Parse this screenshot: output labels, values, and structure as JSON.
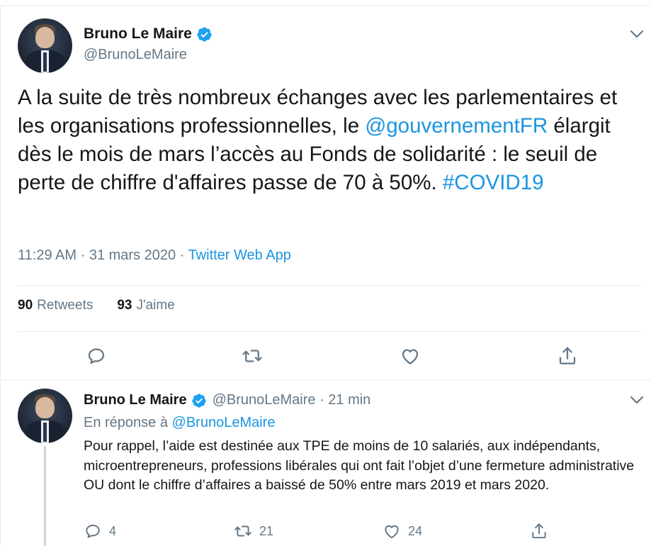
{
  "main_tweet": {
    "display_name": "Bruno Le Maire",
    "handle": "@BrunoLeMaire",
    "text": {
      "part1": "A la suite de très nombreux échanges avec les parlementaires et les organisations professionnelles, le ",
      "mention": "@gouvernementFR",
      "part2": " élargit dès le mois de mars l’accès au Fonds de solidarité : le seuil de perte de chiffre d'affaires passe de 70 à 50%. ",
      "hashtag": "#COVID19"
    },
    "time": "11:29 AM",
    "date": "31 mars 2020",
    "separator": "·",
    "source": "Twitter Web App",
    "retweets_count": "90",
    "retweets_label": "Retweets",
    "likes_count": "93",
    "likes_label": "J'aime"
  },
  "reply_tweet": {
    "display_name": "Bruno Le Maire",
    "handle_time": "@BrunoLeMaire · 21 min",
    "in_reply_prefix": "En réponse à ",
    "in_reply_handle": "@BrunoLeMaire",
    "text": "Pour rappel, l’aide est destinée aux TPE de moins de 10 salariés, aux indépendants, microentrepreneurs, professions libérales qui ont fait l’objet d’une fermeture administrative OU dont le chiffre d’affaires a baissé de 50% entre mars 2019 et mars 2020.",
    "reply_count": "4",
    "retweet_count": "21",
    "like_count": "24"
  },
  "icons": {
    "verified": "verified-badge-icon",
    "caret": "chevron-down-icon",
    "reply": "reply-icon",
    "retweet": "retweet-icon",
    "like": "heart-icon",
    "share": "share-icon"
  },
  "colors": {
    "accent": "#1b95e0",
    "verified": "#1da1f2",
    "secondary_text": "#657786",
    "primary_text": "#14171a",
    "divider": "#e6ecf0"
  }
}
